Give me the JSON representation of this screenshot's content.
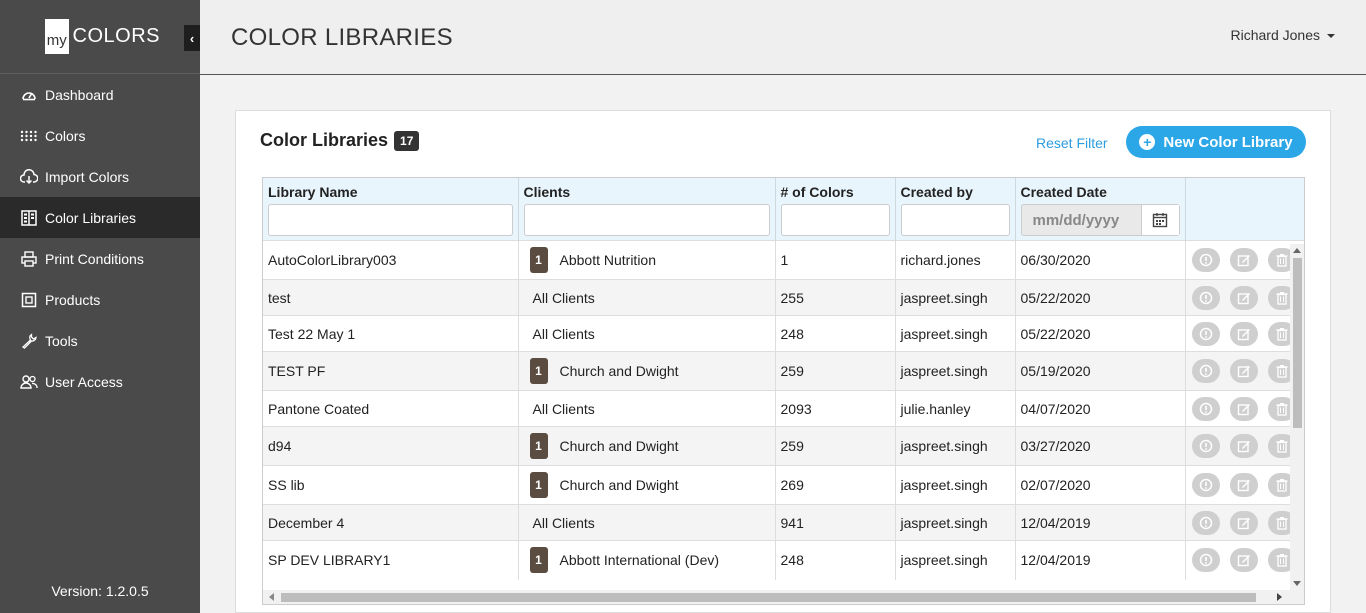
{
  "brand": {
    "logo_prefix": "my",
    "logo_text": "COLORS"
  },
  "sidebar": {
    "items": [
      {
        "label": "Dashboard",
        "icon": "dashboard-icon"
      },
      {
        "label": "Colors",
        "icon": "dots-grid-icon"
      },
      {
        "label": "Import Colors",
        "icon": "cloud-import-icon"
      },
      {
        "label": "Color Libraries",
        "icon": "library-icon",
        "active": true
      },
      {
        "label": "Print Conditions",
        "icon": "printer-icon"
      },
      {
        "label": "Products",
        "icon": "box-icon"
      },
      {
        "label": "Tools",
        "icon": "wrench-icon"
      },
      {
        "label": "User Access",
        "icon": "users-icon"
      }
    ],
    "version": "Version: 1.2.0.5"
  },
  "header": {
    "title": "COLOR LIBRARIES",
    "user": "Richard Jones"
  },
  "card": {
    "title": "Color Libraries",
    "count": "17",
    "reset_label": "Reset Filter",
    "new_label": "New Color Library"
  },
  "table": {
    "columns": [
      "Library Name",
      "Clients",
      "# of Colors",
      "Created by",
      "Created Date"
    ],
    "date_placeholder": "mm/dd/yyyy",
    "rows": [
      {
        "name": "AutoColorLibrary003",
        "badge": "1",
        "client": "Abbott Nutrition",
        "colors": "1",
        "by": "richard.jones",
        "date": "06/30/2020"
      },
      {
        "name": "test",
        "badge": "",
        "client": "All Clients",
        "colors": "255",
        "by": "jaspreet.singh",
        "date": "05/22/2020"
      },
      {
        "name": "Test 22 May 1",
        "badge": "",
        "client": "All Clients",
        "colors": "248",
        "by": "jaspreet.singh",
        "date": "05/22/2020"
      },
      {
        "name": "TEST PF",
        "badge": "1",
        "client": "Church and Dwight",
        "colors": "259",
        "by": "jaspreet.singh",
        "date": "05/19/2020"
      },
      {
        "name": "Pantone Coated",
        "badge": "",
        "client": "All Clients",
        "colors": "2093",
        "by": "julie.hanley",
        "date": "04/07/2020"
      },
      {
        "name": "d94",
        "badge": "1",
        "client": "Church and Dwight",
        "colors": "259",
        "by": "jaspreet.singh",
        "date": "03/27/2020"
      },
      {
        "name": "SS lib",
        "badge": "1",
        "client": "Church and Dwight",
        "colors": "269",
        "by": "jaspreet.singh",
        "date": "02/07/2020"
      },
      {
        "name": "December 4",
        "badge": "",
        "client": "All Clients",
        "colors": "941",
        "by": "jaspreet.singh",
        "date": "12/04/2019"
      },
      {
        "name": "SP DEV LIBRARY1",
        "badge": "1",
        "client": "Abbott International (Dev)",
        "colors": "248",
        "by": "jaspreet.singh",
        "date": "12/04/2019"
      }
    ]
  }
}
